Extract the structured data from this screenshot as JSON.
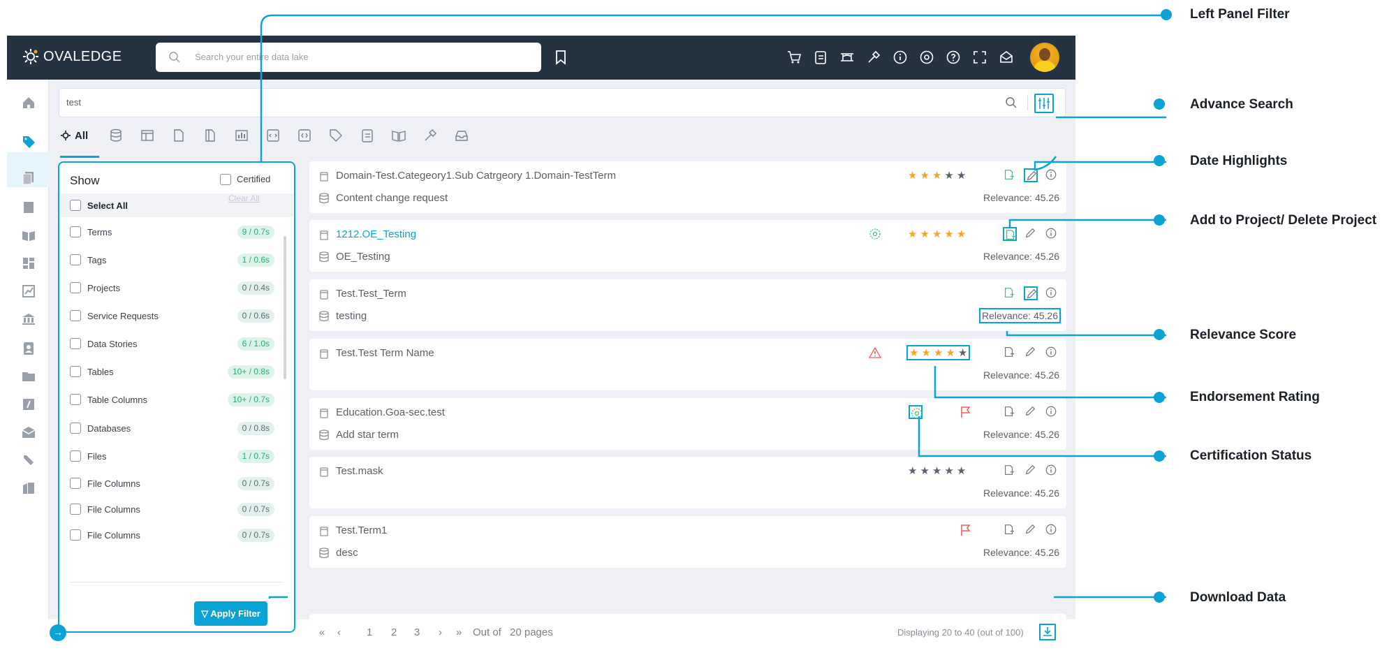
{
  "header": {
    "logo_prefix": "OVAL",
    "logo_suffix": "EDGE",
    "search_placeholder": "Search your entire data lake"
  },
  "main_search": {
    "value": "test"
  },
  "type_tabs": {
    "all_label": "All"
  },
  "filter": {
    "title": "Show",
    "certified_label": "Certified",
    "select_all_label": "Select All",
    "clear_all_label": "Clear All",
    "apply_label": "Apply Filter",
    "items": [
      {
        "label": "Terms",
        "count": "9 / 0.7s"
      },
      {
        "label": "Tags",
        "count": "1 / 0.6s"
      },
      {
        "label": "Projects",
        "count": "0 / 0.4s"
      },
      {
        "label": "Service Requests",
        "count": "0 / 0.6s"
      },
      {
        "label": "Data Stories",
        "count": "6 / 1.0s"
      },
      {
        "label": "Tables",
        "count": "10+ / 0.8s"
      },
      {
        "label": "Table Columns",
        "count": "10+ / 0.7s"
      },
      {
        "label": "Databases",
        "count": "0 / 0.8s"
      },
      {
        "label": "Files",
        "count": "1 / 0.7s"
      },
      {
        "label": "File Columns",
        "count": "0 / 0.7s"
      },
      {
        "label": "File Columns",
        "count": "0 / 0.7s"
      },
      {
        "label": "File Columns",
        "count": "0 / 0.7s"
      }
    ]
  },
  "results": [
    {
      "title": "Domain-Test.Categeory1.Sub Catrgeory 1.Domain-TestTerm",
      "subtitle": "Content change request",
      "relevance": "Relevance: 45.26",
      "stars": 3
    },
    {
      "title": "1212.OE_Testing",
      "subtitle": "OE_Testing",
      "relevance": "Relevance: 45.26",
      "stars": 5
    },
    {
      "title": "Test.Test_Term",
      "subtitle": "testing",
      "relevance": "Relevance: 45.26",
      "stars": 0
    },
    {
      "title": "Test.Test Term Name",
      "subtitle": "",
      "relevance": "Relevance: 45.26",
      "stars": 4
    },
    {
      "title": "Education.Goa-sec.test",
      "subtitle": "Add star term",
      "relevance": "Relevance: 45.26",
      "stars": 0
    },
    {
      "title": "Test.mask",
      "subtitle": "",
      "relevance": "Relevance: 45.26",
      "stars": 0
    },
    {
      "title": "Test.Term1",
      "subtitle": "desc",
      "relevance": "Relevance: 45.26",
      "stars": 0
    }
  ],
  "pager": {
    "pages": [
      "1",
      "2",
      "3"
    ],
    "out_of": "Out of",
    "total_pages": "20 pages",
    "displaying": "Displaying 20 to 40 (out of 100)"
  },
  "callouts": {
    "left_panel_filter": "Left Panel Filter",
    "advance_search": "Advance Search",
    "date_highlights": "Date Highlights",
    "add_to_project": "Add to Project/ Delete Project",
    "relevance_score": "Relevance Score",
    "endorsement_rating": "Endorsement Rating",
    "certification_status": "Certification Status",
    "download_data": "Download Data"
  },
  "colors": {
    "accent": "#0ba3d6",
    "topbar": "#243242",
    "star": "#f6a623",
    "flag": "#ef5a5a"
  }
}
